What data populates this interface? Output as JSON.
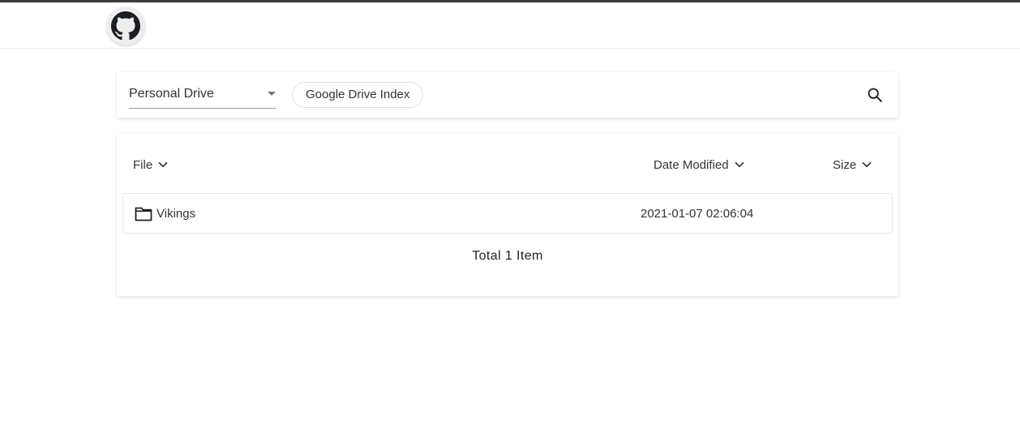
{
  "header": {
    "github_icon": "github-icon"
  },
  "toolbar": {
    "drive_selected": "Personal Drive",
    "chip_label": "Google Drive Index",
    "search_icon": "search-icon"
  },
  "list": {
    "columns": {
      "file": "File",
      "date_modified": "Date Modified",
      "size": "Size"
    },
    "rows": [
      {
        "icon": "folder-icon",
        "name": "Vikings",
        "date": "2021-01-07 02:06:04",
        "size": ""
      }
    ],
    "total_label": "Total 1 Item"
  },
  "colors": {
    "topline": "#3c3c3c",
    "github_button_bg": "#eeeeee"
  }
}
